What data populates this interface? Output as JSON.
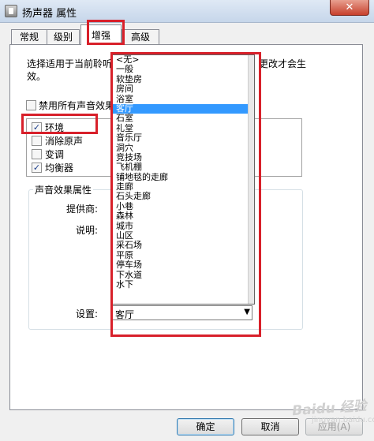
{
  "window": {
    "title": "扬声器 属性",
    "close_glyph": "✕"
  },
  "tabs": [
    {
      "label": "常规",
      "active": false
    },
    {
      "label": "级别",
      "active": false
    },
    {
      "label": "增强",
      "active": true
    },
    {
      "label": "高级",
      "active": false
    }
  ],
  "enhance": {
    "description_line1": "选择适用于当前聆听",
    "description_line1_tail": "更改才会生",
    "description_line2": "效。",
    "disable_all_label": "禁用所有声音效果",
    "disable_all_checked": false,
    "effects": [
      {
        "label": "环境",
        "checked": true
      },
      {
        "label": "消除原声",
        "checked": false
      },
      {
        "label": "变调",
        "checked": false
      },
      {
        "label": "均衡器",
        "checked": true
      }
    ],
    "properties_group_title": "声音效果属性",
    "provider_label": "提供商:",
    "description_label": "说明:",
    "setting_label": "设置:",
    "setting_value": "客厅",
    "selected_index": 5,
    "dropdown_options": [
      "<无>",
      "一般",
      "软垫房",
      "房间",
      "浴室",
      "客厅",
      "石室",
      "礼堂",
      "音乐厅",
      "洞穴",
      "竞技场",
      "飞机棚",
      "铺地毯的走廊",
      "走廊",
      "石头走廊",
      "小巷",
      "森林",
      "城市",
      "山区",
      "采石场",
      "平原",
      "停车场",
      "下水道",
      "水下"
    ]
  },
  "buttons": {
    "ok": "确定",
    "cancel": "取消",
    "apply": "应用(A)"
  },
  "colors": {
    "highlight": "#3399ff",
    "annotation": "#d8202a"
  },
  "watermark": {
    "text": "Baidu 经验",
    "sub": "jingyan.baidu.com"
  }
}
